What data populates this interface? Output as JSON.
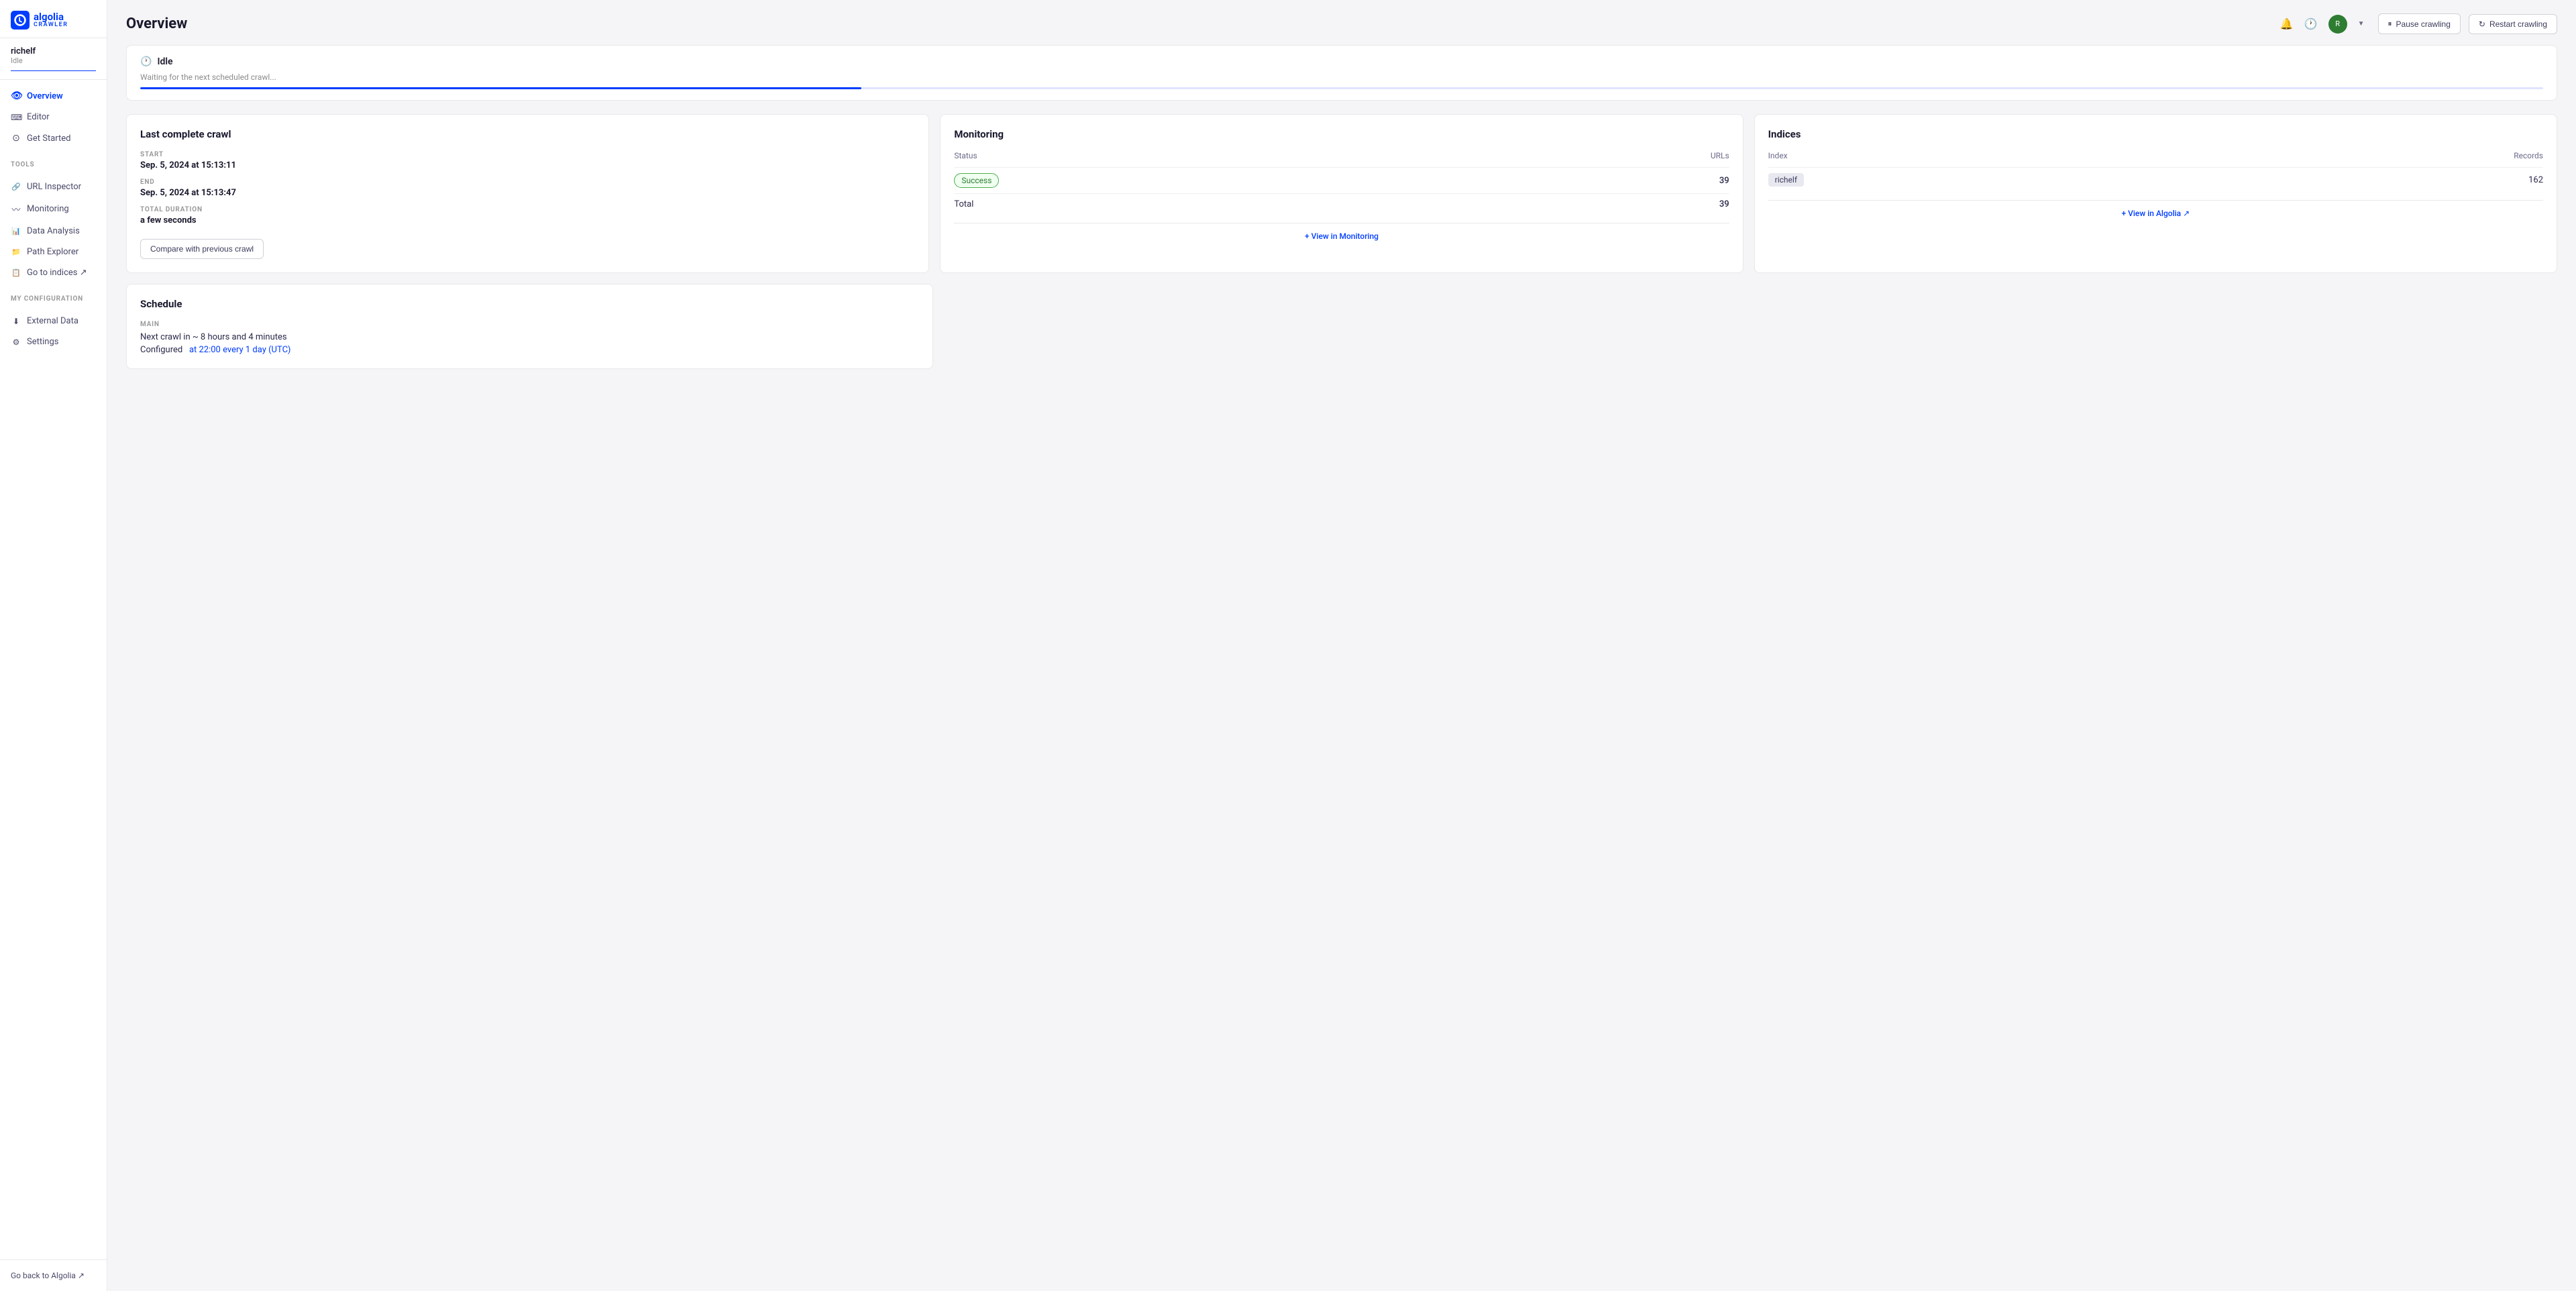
{
  "logo": {
    "algolia": "algolia",
    "crawler": "CRAWLER"
  },
  "user": {
    "name": "richelf",
    "status": "Idle"
  },
  "nav": {
    "main_items": [
      {
        "id": "overview",
        "label": "Overview",
        "icon": "👁",
        "active": true
      },
      {
        "id": "editor",
        "label": "Editor",
        "icon": "⌨",
        "active": false
      },
      {
        "id": "get-started",
        "label": "Get Started",
        "icon": "⊙",
        "active": false
      }
    ],
    "tools_label": "TOOLS",
    "tools_items": [
      {
        "id": "url-inspector",
        "label": "URL Inspector",
        "icon": "🔗"
      },
      {
        "id": "monitoring",
        "label": "Monitoring",
        "icon": "〰"
      },
      {
        "id": "data-analysis",
        "label": "Data Analysis",
        "icon": "📊"
      },
      {
        "id": "path-explorer",
        "label": "Path Explorer",
        "icon": "📁"
      },
      {
        "id": "go-to-indices",
        "label": "Go to indices ↗",
        "icon": "📋"
      }
    ],
    "config_label": "MY CONFIGURATION",
    "config_items": [
      {
        "id": "external-data",
        "label": "External Data",
        "icon": "⬇"
      },
      {
        "id": "settings",
        "label": "Settings",
        "icon": "⚙"
      }
    ],
    "footer_link": "Go back to Algolia ↗"
  },
  "header": {
    "title": "Overview",
    "pause_btn": "Pause crawling",
    "restart_btn": "Restart crawling"
  },
  "status_bar": {
    "icon": "🕐",
    "title": "Idle",
    "subtitle": "Waiting for the next scheduled crawl..."
  },
  "last_crawl": {
    "card_title": "Last complete crawl",
    "start_label": "START",
    "start_value": "Sep. 5, 2024 at 15:13:11",
    "end_label": "END",
    "end_value": "Sep. 5, 2024 at 15:13:47",
    "duration_label": "TOTAL DURATION",
    "duration_value": "a few seconds",
    "compare_btn": "Compare with previous crawl"
  },
  "monitoring": {
    "card_title": "Monitoring",
    "status_col": "Status",
    "urls_col": "URLs",
    "rows": [
      {
        "label": "Success",
        "value": "39",
        "badge": true
      },
      {
        "label": "Total",
        "value": "39",
        "badge": false
      }
    ],
    "view_link": "+ View in Monitoring"
  },
  "indices": {
    "card_title": "Indices",
    "index_col": "Index",
    "records_col": "Records",
    "rows": [
      {
        "name": "richelf",
        "records": "162"
      }
    ],
    "view_link": "+ View in Algolia ↗"
  },
  "schedule": {
    "card_title": "Schedule",
    "main_label": "MAIN",
    "next_crawl": "Next crawl in ~ 8 hours and 4 minutes",
    "configured_label": "Configured",
    "configured_link": "at 22:00 every 1 day (UTC)"
  }
}
